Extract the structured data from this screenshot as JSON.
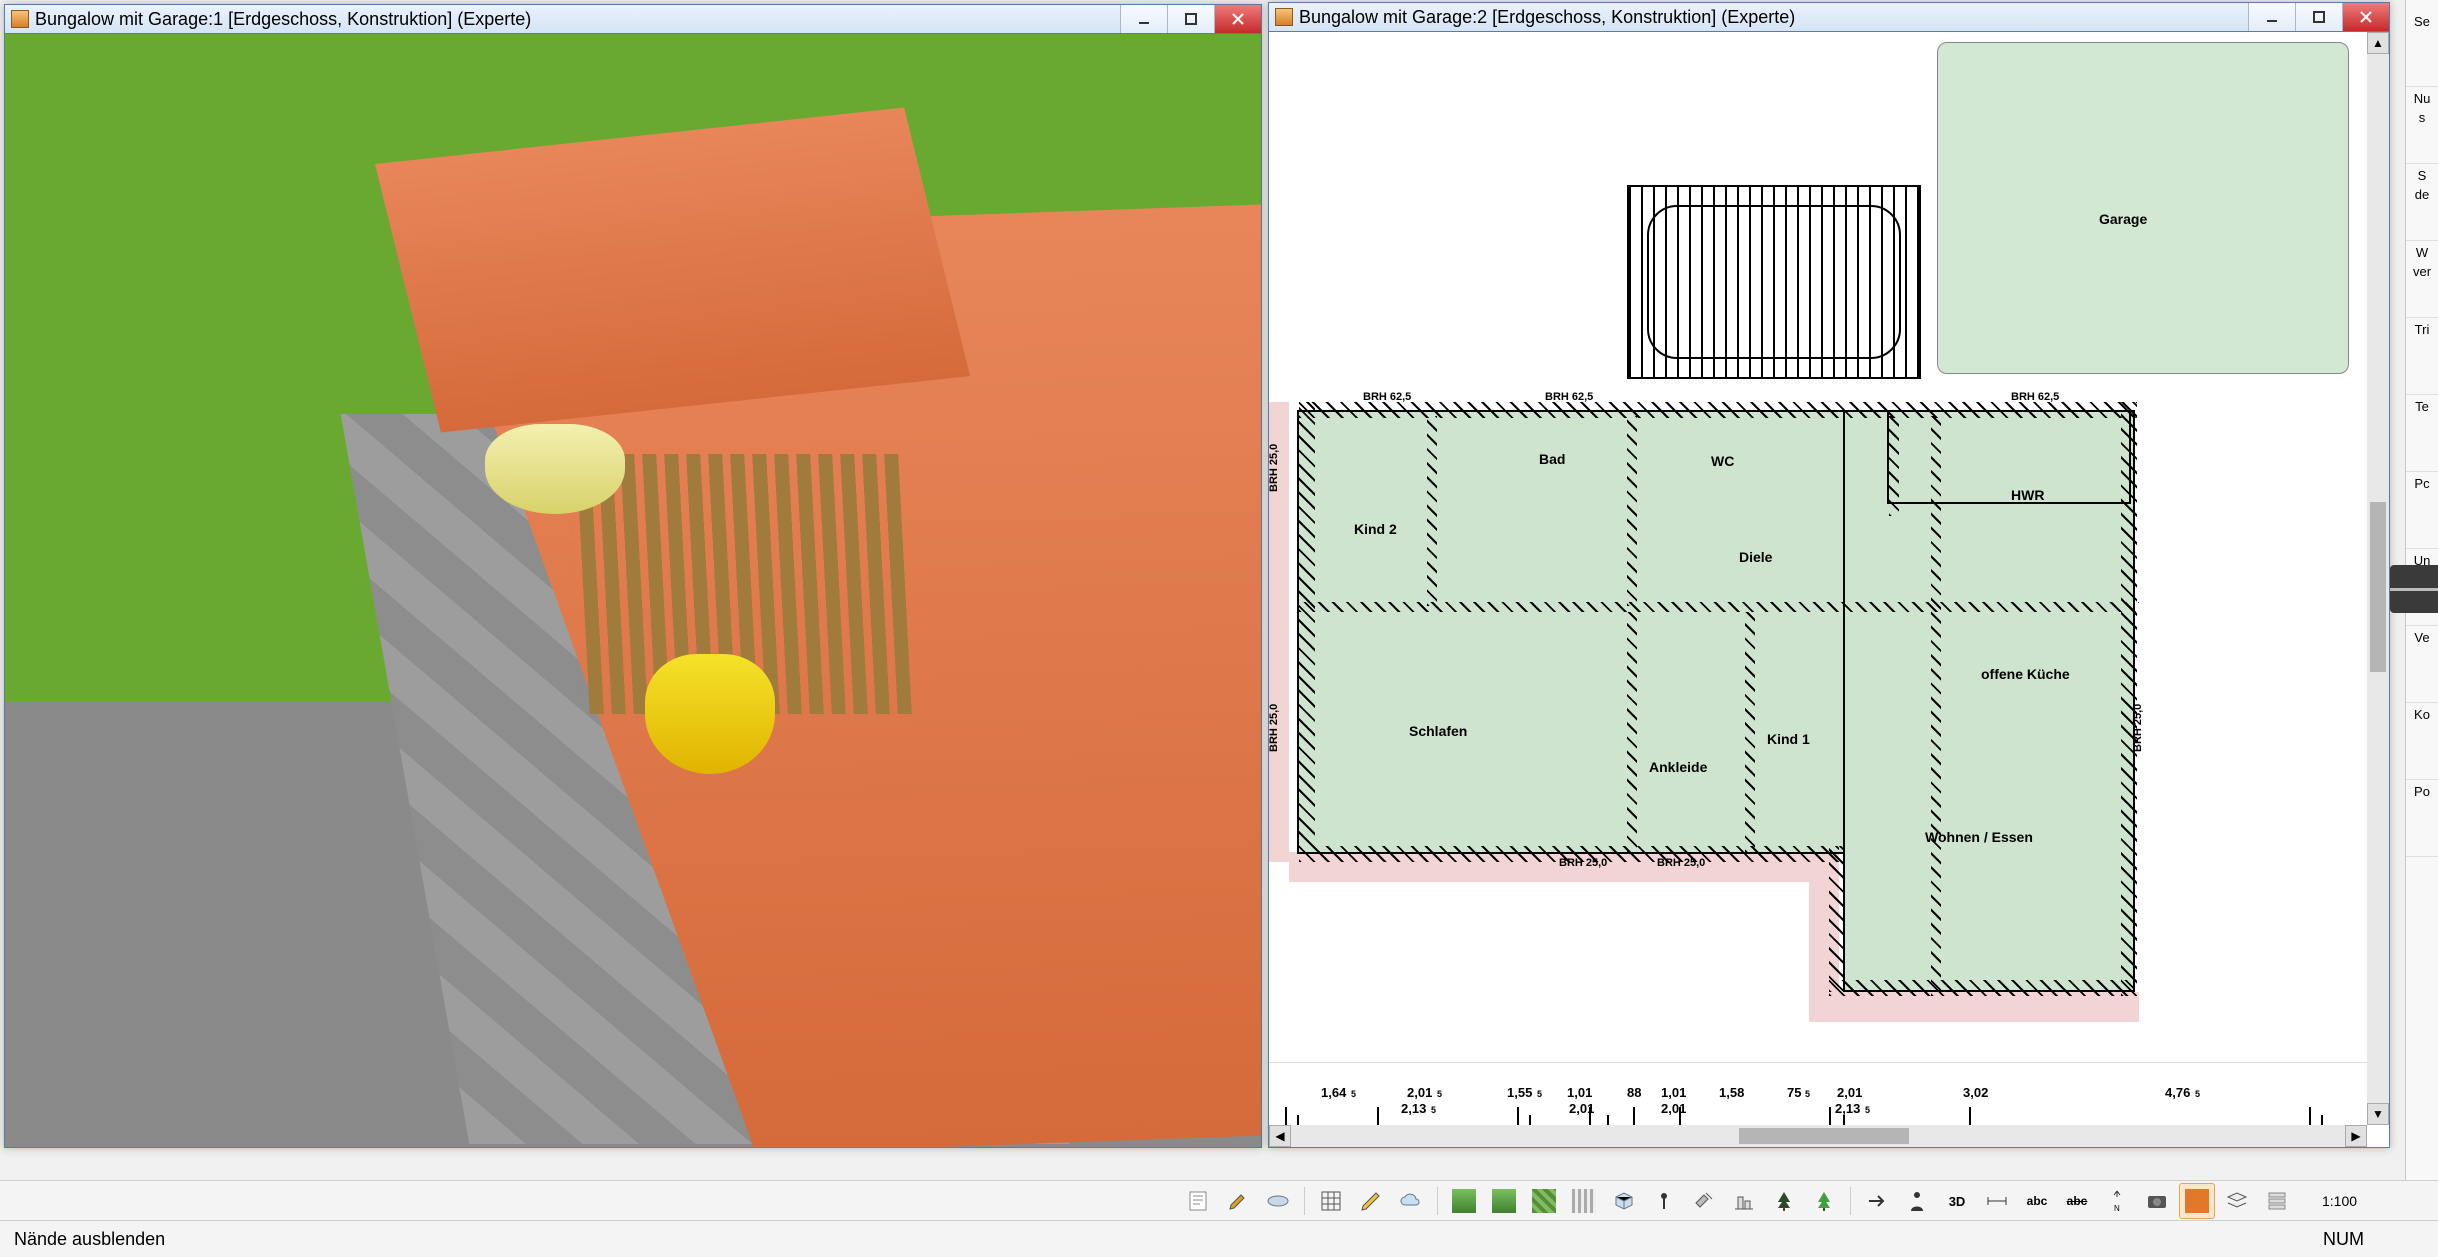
{
  "windows": {
    "left": {
      "title": "Bungalow mit Garage:1  [Erdgeschoss, Konstruktion]  (Experte)"
    },
    "right": {
      "title": "Bungalow mit Garage:2  [Erdgeschoss, Konstruktion]  (Experte)"
    }
  },
  "rooms": {
    "garage": "Garage",
    "wc": "WC",
    "bad": "Bad",
    "kind2": "Kind 2",
    "diele": "Diele",
    "hwr": "HWR",
    "schlafen": "Schlafen",
    "ankleide": "Ankleide",
    "kind1": "Kind 1",
    "kueche": "offene Küche",
    "wohnen": "Wohnen / Essen"
  },
  "brh": {
    "top1": "BRH 62,5",
    "top2": "BRH 62,5",
    "top3": "BRH 62,5",
    "left1": "BRH 25,0",
    "left2": "BRH 25,0",
    "bot1": "BRH 25,0",
    "bot2": "BRH 25,0",
    "right1": "BRH 25,0"
  },
  "ruler": {
    "m0": "1,64",
    "m1": "2,01",
    "m1b": "2,13",
    "m2": "1,55",
    "m3": "1,01",
    "m3b": "2,01",
    "m4": "88",
    "m4b": "2,01",
    "m5": "1,01",
    "m5b": "2,01",
    "m6": "1,58",
    "m7": "75",
    "m8": "2,01",
    "m8b": "2,13",
    "m9": "3,02",
    "m10": "4,76",
    "sup": "5"
  },
  "side_panel": {
    "rows": [
      {
        "label": "Se"
      },
      {
        "label": "Nu",
        "label2": "s"
      },
      {
        "label": "S",
        "label2": "de"
      },
      {
        "label": "W",
        "label2": "ver"
      },
      {
        "label": "Tri"
      },
      {
        "label": "Te"
      },
      {
        "label": "Pc"
      },
      {
        "label": "Un"
      },
      {
        "label": "Ve"
      },
      {
        "label": "Ko"
      },
      {
        "label": "Po"
      }
    ]
  },
  "statusbar": {
    "hint": "Nände ausblenden",
    "scale": "1:100",
    "num": "NUM"
  },
  "toolbar_icons": [
    "notepad-icon",
    "pen-icon",
    "plate-icon",
    "sep",
    "grid-icon",
    "pencil-icon",
    "cloud-icon",
    "sep",
    "terrain-green-icon",
    "terrain-edit-icon",
    "terrain-hatch-icon",
    "raster-icon",
    "box3d-icon",
    "pin-icon",
    "hammer-icon",
    "section-icon",
    "tree-dark-icon",
    "tree-green-icon",
    "sep",
    "arrow-icon",
    "person-icon",
    "3d-icon",
    "dimension-icon",
    "abc-icon",
    "strike-icon",
    "compass-icon",
    "camera-icon",
    "orange-icon",
    "layers-icon",
    "text-layers-icon"
  ]
}
